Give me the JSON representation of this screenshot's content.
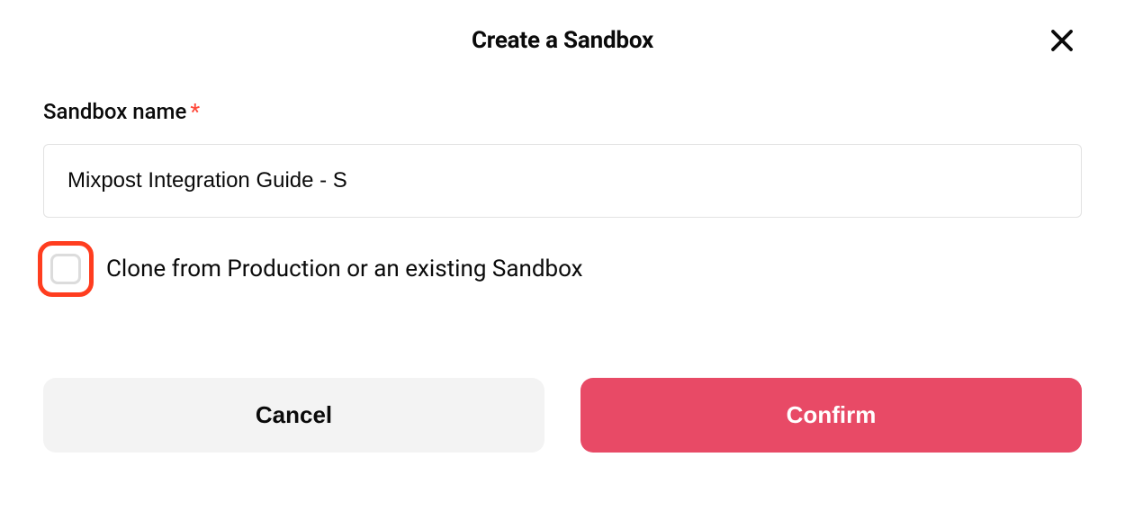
{
  "modal": {
    "title": "Create a Sandbox",
    "form": {
      "name_label": "Sandbox name",
      "name_value": "Mixpost Integration Guide - S",
      "clone_label": "Clone from Production or an existing Sandbox",
      "clone_checked": false
    },
    "buttons": {
      "cancel": "Cancel",
      "confirm": "Confirm"
    },
    "colors": {
      "accent": "#e84a66",
      "highlight_ring": "#ff3d1f",
      "required": "#ff4a3b"
    }
  }
}
